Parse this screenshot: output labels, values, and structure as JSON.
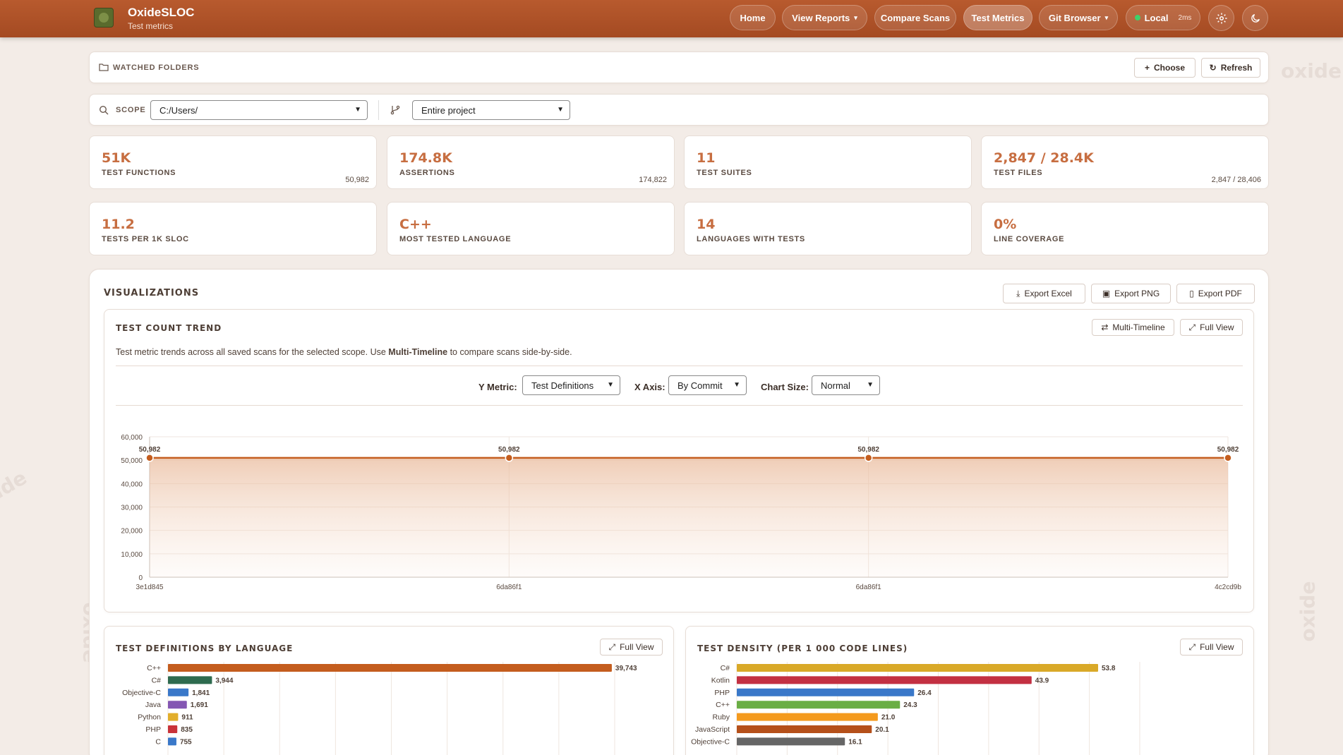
{
  "app": {
    "title": "OxideSLOC",
    "subtitle": "Test metrics"
  },
  "nav": {
    "home": "Home",
    "view_reports": "View Reports",
    "compare_scans": "Compare Scans",
    "test_metrics": "Test Metrics",
    "git_browser": "Git Browser",
    "server": "Local",
    "latency": "2ms"
  },
  "watched": {
    "label": "WATCHED FOLDERS",
    "choose": "Choose",
    "refresh": "Refresh"
  },
  "scope": {
    "label": "SCOPE",
    "path": "C:/Users/",
    "range": "Entire project"
  },
  "cards": [
    {
      "value": "51K",
      "label": "TEST FUNCTIONS",
      "sub": "50,982"
    },
    {
      "value": "174.8K",
      "label": "ASSERTIONS",
      "sub": "174,822"
    },
    {
      "value": "11",
      "label": "TEST SUITES",
      "sub": ""
    },
    {
      "value": "2,847 / 28.4K",
      "label": "TEST FILES",
      "sub": "2,847 / 28,406"
    },
    {
      "value": "11.2",
      "label": "TESTS PER 1K SLOC",
      "sub": ""
    },
    {
      "value": "C++",
      "label": "MOST TESTED LANGUAGE",
      "sub": ""
    },
    {
      "value": "14",
      "label": "LANGUAGES WITH TESTS",
      "sub": ""
    },
    {
      "value": "0%",
      "label": "LINE COVERAGE",
      "sub": ""
    }
  ],
  "viz": {
    "title": "VISUALIZATIONS",
    "export_excel": "Export Excel",
    "export_png": "Export PNG",
    "export_pdf": "Export PDF"
  },
  "trend": {
    "title": "TEST COUNT TREND",
    "multi_timeline": "Multi-Timeline",
    "full_view": "Full View",
    "desc_before": "Test metric trends across all saved scans for the selected scope. Use ",
    "desc_bold": "Multi-Timeline",
    "desc_after": " to compare scans side-by-side.",
    "y_metric_label": "Y Metric:",
    "y_metric_value": "Test Definitions",
    "x_axis_label": "X Axis:",
    "x_axis_value": "By Commit",
    "size_label": "Chart Size:",
    "size_value": "Normal"
  },
  "by_language": {
    "title": "TEST DEFINITIONS BY LANGUAGE",
    "full_view": "Full View"
  },
  "density": {
    "title": "TEST DENSITY (PER 1 000 CODE LINES)",
    "full_view": "Full View"
  },
  "chart_data": [
    {
      "type": "line",
      "title": "TEST COUNT TREND",
      "categories": [
        "3e1d845",
        "6da86f1",
        "6da86f1",
        "4c2cd9b"
      ],
      "values": [
        50982,
        50982,
        50982,
        50982
      ],
      "point_labels": [
        "50,982",
        "50,982",
        "50,982",
        "50,982"
      ],
      "ylim": [
        0,
        60000
      ],
      "yticks": [
        "0",
        "10,000",
        "20,000",
        "30,000",
        "40,000",
        "50,000",
        "60,000"
      ],
      "grid": true,
      "color": "#c45d1e"
    },
    {
      "type": "bar",
      "orientation": "horizontal",
      "title": "TEST DEFINITIONS BY LANGUAGE",
      "categories": [
        "C++",
        "C#",
        "Objective-C",
        "Java",
        "Python",
        "PHP",
        "C"
      ],
      "values": [
        39743,
        3944,
        1841,
        1691,
        911,
        835,
        755
      ],
      "value_labels": [
        "39,743",
        "3,944",
        "1,841",
        "1,691",
        "911",
        "835",
        "755"
      ],
      "colors": [
        "#c45d1e",
        "#2e6b4f",
        "#3a78c9",
        "#8457b3",
        "#e2ae2b",
        "#c9333a",
        "#3a78c9"
      ],
      "xlim": [
        0,
        40000
      ],
      "grid": true
    },
    {
      "type": "bar",
      "orientation": "horizontal",
      "title": "TEST DENSITY (PER 1 000 CODE LINES)",
      "categories": [
        "C#",
        "Kotlin",
        "PHP",
        "C++",
        "Ruby",
        "JavaScript",
        "Objective-C"
      ],
      "values": [
        53.8,
        43.9,
        26.4,
        24.3,
        21.0,
        20.1,
        16.1
      ],
      "value_labels": [
        "53.8",
        "43.9",
        "26.4",
        "24.3",
        "21.0",
        "20.1",
        "16.1"
      ],
      "colors": [
        "#d9a928",
        "#c33042",
        "#3a78c9",
        "#6aae45",
        "#f49a1e",
        "#b5501a",
        "#666666"
      ],
      "xlim": [
        0,
        60
      ],
      "grid": true
    }
  ]
}
